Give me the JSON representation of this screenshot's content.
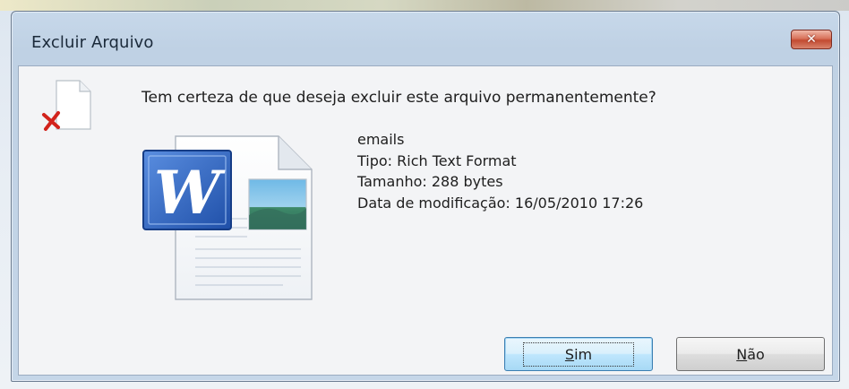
{
  "dialog": {
    "title": "Excluir Arquivo",
    "close_glyph": "✕",
    "question": "Tem certeza de que deseja excluir este arquivo permanentemente?",
    "file": {
      "name": "emails",
      "type": "Tipo: Rich Text Format",
      "size": "Tamanho: 288 bytes",
      "modified": "Data de modificação: 16/05/2010 17:26"
    },
    "buttons": {
      "yes": {
        "mnemonic": "S",
        "rest": "im"
      },
      "no": {
        "mnemonic": "N",
        "rest": "ão"
      }
    },
    "icons": {
      "delete": "delete-file-icon",
      "document": "word-document-icon"
    },
    "colors": {
      "close_button": "#c24a31",
      "default_button_border": "#3c7fb1",
      "word_blue": "#2a5cb8"
    }
  }
}
